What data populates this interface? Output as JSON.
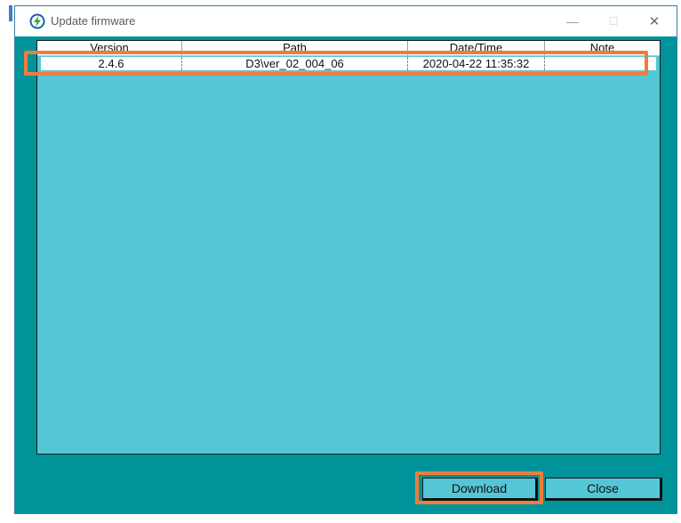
{
  "window": {
    "title": "Update firmware",
    "minimize_glyph": "—",
    "maximize_glyph": "☐",
    "close_glyph": "✕"
  },
  "table": {
    "columns": [
      "Version",
      "Path",
      "Date/Time",
      "Note"
    ],
    "rows": [
      {
        "version": "2.4.6",
        "path": "D3\\ver_02_004_06",
        "datetime": "2020-04-22  11:35:32",
        "note": ""
      }
    ]
  },
  "buttons": {
    "download": "Download",
    "close": "Close"
  },
  "colors": {
    "window_bg": "#00939a",
    "list_bg": "#55c6d6",
    "highlight": "#ee7d3a"
  },
  "icons": {
    "app": "lightning-circle-icon"
  }
}
